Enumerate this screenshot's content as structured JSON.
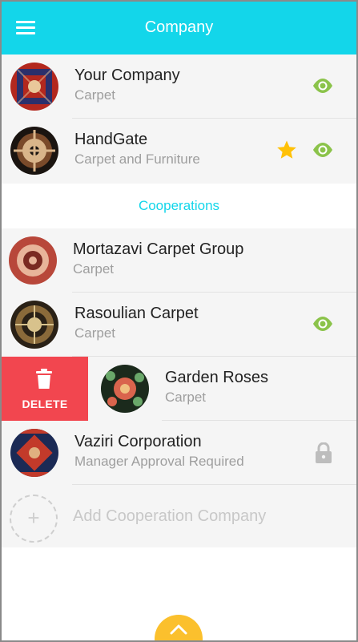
{
  "appbar": {
    "title": "Company",
    "menu_icon": "menu-icon"
  },
  "my_companies": [
    {
      "name": "Your Company",
      "subtitle": "Carpet",
      "avatar_colors": [
        "#b3281e",
        "#2b2f6b",
        "#e9c79a"
      ],
      "icons": [
        "eye-icon"
      ]
    },
    {
      "name": "HandGate",
      "subtitle": "Carpet and Furniture",
      "avatar_colors": [
        "#1a1410",
        "#d9b58a",
        "#7a4a2a"
      ],
      "icons": [
        "star-icon",
        "eye-icon"
      ]
    }
  ],
  "cooperations": {
    "header": "Cooperations",
    "items": [
      {
        "name": "Mortazavi Carpet Group",
        "subtitle": "Carpet",
        "avatar_colors": [
          "#b8473a",
          "#e8b49a",
          "#7a2a22"
        ],
        "icons": []
      },
      {
        "name": "Rasoulian Carpet",
        "subtitle": "Carpet",
        "avatar_colors": [
          "#2a2116",
          "#d8c28c",
          "#8a6a3a"
        ],
        "icons": [
          "eye-icon"
        ]
      },
      {
        "name": "Garden Roses",
        "subtitle": "Carpet",
        "avatar_colors": [
          "#1b2a1c",
          "#d9644d",
          "#6aa86a"
        ],
        "icons": [],
        "delete_label": "DELETE"
      },
      {
        "name": "Vaziri Corporation",
        "subtitle": "Manager Approval Required",
        "avatar_colors": [
          "#1b2a55",
          "#c23a2a",
          "#e0b080"
        ],
        "icons": [
          "lock-icon"
        ]
      }
    ],
    "add_label": "Add Cooperation Company"
  },
  "colors": {
    "primary": "#13d6ea",
    "eye": "#8bc34a",
    "star": "#ffc107",
    "lock": "#bdbdbd",
    "delete": "#f2464f",
    "fab": "#fbc02d"
  },
  "fab_icon": "chevron-up-icon"
}
